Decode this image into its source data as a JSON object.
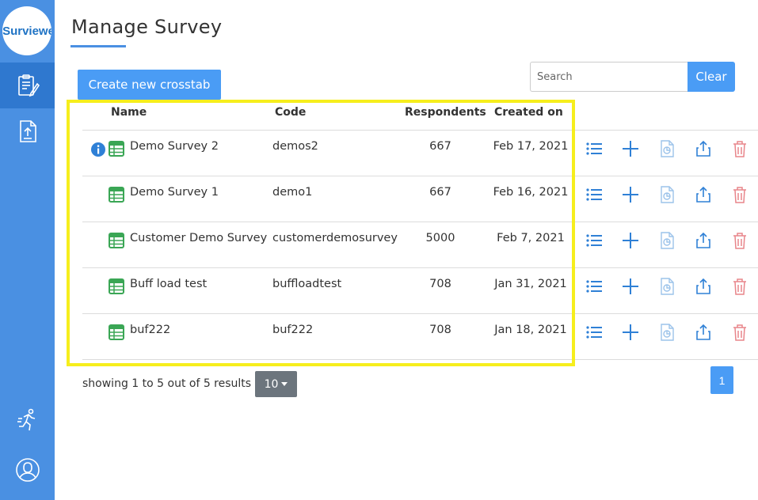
{
  "app": {
    "logo_text": "Surviewe"
  },
  "sidebar": {
    "items": [
      {
        "icon": "survey-clipboard-icon",
        "active": true
      },
      {
        "icon": "upload-file-icon",
        "active": false
      },
      {
        "icon": "runner-icon",
        "active": false
      },
      {
        "icon": "user-avatar-icon",
        "active": false
      }
    ]
  },
  "page": {
    "title": "Manage Survey"
  },
  "toolbar": {
    "create_label": "Create new crosstab",
    "search_placeholder": "Search",
    "search_value": "",
    "clear_label": "Clear"
  },
  "table": {
    "columns": [
      "Name",
      "Code",
      "Respondents",
      "Created on"
    ],
    "rows": [
      {
        "name": "Demo Survey 2",
        "code": "demos2",
        "respondents": "667",
        "created": "Feb 17, 2021",
        "info": true
      },
      {
        "name": "Demo Survey 1",
        "code": "demo1",
        "respondents": "667",
        "created": "Feb 16, 2021",
        "info": false
      },
      {
        "name": "Customer Demo Survey",
        "code": "customerdemosurvey",
        "respondents": "5000",
        "created": "Feb 7, 2021",
        "info": false
      },
      {
        "name": "Buff load test",
        "code": "buffloadtest",
        "respondents": "708",
        "created": "Jan 31, 2021",
        "info": false
      },
      {
        "name": "buf222",
        "code": "buf222",
        "respondents": "708",
        "created": "Jan 18, 2021",
        "info": false
      }
    ],
    "row_actions": [
      "list-icon",
      "plus-icon",
      "report-file-icon",
      "share-upload-icon",
      "trash-icon"
    ]
  },
  "footer": {
    "showing_text": "showing 1 to 5 out of 5 results",
    "page_size": "10",
    "current_page": "1"
  },
  "colors": {
    "sidebar": "#4a90e2",
    "primary": "#4a9cf5",
    "highlight": "#f6ee1c",
    "trash": "#e8858a",
    "sheet": "#3aa655"
  }
}
